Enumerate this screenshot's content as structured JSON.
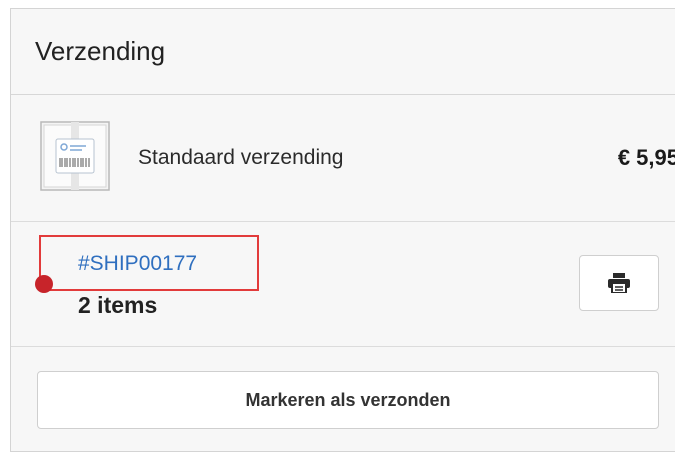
{
  "shipping": {
    "title": "Verzending",
    "method": {
      "label": "Standaard verzending",
      "price": "€ 5,95",
      "icon": "package-label-icon"
    },
    "shipment": {
      "id": "#SHIP00177",
      "items": "2 items",
      "print_icon": "printer-icon"
    },
    "mark_button_label": "Markeren als verzonden"
  },
  "colors": {
    "link": "#2f6fbf",
    "highlight_border": "#e23b3b",
    "marker_dot": "#c7242a"
  }
}
